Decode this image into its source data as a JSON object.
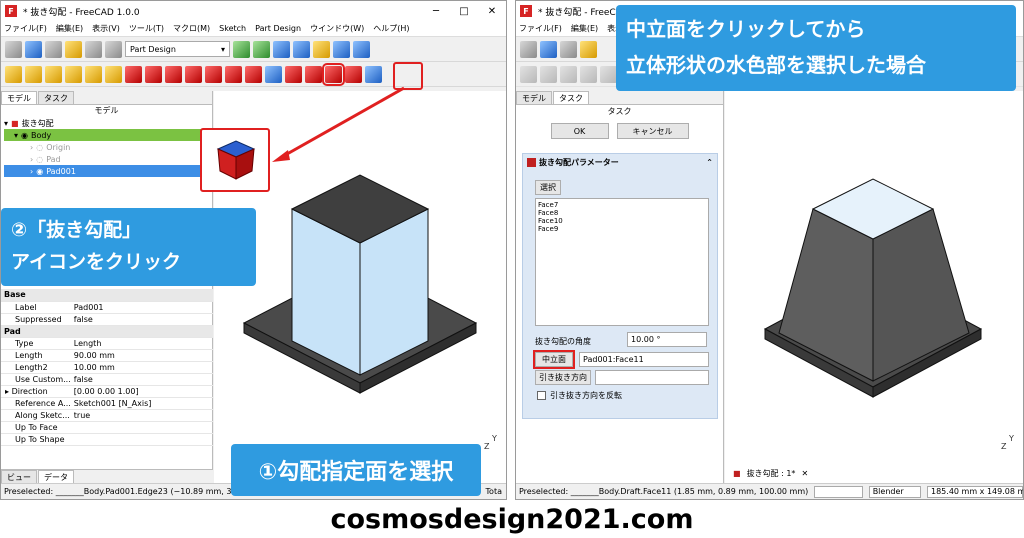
{
  "left": {
    "title": "* 抜き勾配 - FreeCAD 1.0.0",
    "menu": [
      "ファイル(F)",
      "編集(E)",
      "表示(V)",
      "ツール(T)",
      "マクロ(M)",
      "Sketch",
      "Part Design",
      "ウインドウ(W)",
      "ヘルプ(H)"
    ],
    "workbench": "Part Design",
    "tabs": [
      "モデル",
      "タスク"
    ],
    "panel_title": "モデル",
    "tree": {
      "doc": "抜き勾配",
      "body": "Body",
      "origin": "Origin",
      "pad": "Pad",
      "pad001": "Pad001"
    },
    "props": {
      "group_base": "Base",
      "label_k": "Label",
      "label_v": "Pad001",
      "suppressed_k": "Suppressed",
      "suppressed_v": "false",
      "group_pad": "Pad",
      "type_k": "Type",
      "type_v": "Length",
      "length_k": "Length",
      "length_v": "90.00 mm",
      "length2_k": "Length2",
      "length2_v": "10.00 mm",
      "usecustom_k": "Use Custom...",
      "usecustom_v": "false",
      "direction_k": "Direction",
      "direction_v": "[0.00 0.00 1.00]",
      "reference_k": "Reference A...",
      "reference_v": "Sketch001 [N_Axis]",
      "along_k": "Along Sketc...",
      "along_v": "true",
      "uptoface_k": "Up To Face",
      "uptoshape_k": "Up To Shape"
    },
    "bottom_tabs": [
      "ビュー",
      "データ"
    ],
    "status": "Preselected: _______Body.Pad001.Edge23 (−10.89 mm, 30",
    "status_right": "Tota",
    "callout_top": "②「抜き勾配」\nアイコンをクリック",
    "callout_bottom": "①勾配指定面を選択"
  },
  "right": {
    "title": "* 抜き勾配 - FreeCAD",
    "menu": [
      "ファイル(F)",
      "編集(E)",
      "表示("
    ],
    "tabs": [
      "モデル",
      "タスク"
    ],
    "panel_title": "タスク",
    "ok": "OK",
    "cancel": "キャンセル",
    "params_title": "抜き勾配パラメーター",
    "select_btn": "選択",
    "faces": [
      "Face7",
      "Face8",
      "Face10",
      "Face9"
    ],
    "angle_label": "抜き勾配の角度",
    "angle_value": "10.00 °",
    "neutral_btn": "中立面",
    "neutral_value": "Pad001:Face11",
    "pull_btn": "引き抜き方向",
    "reverse_label": "引き抜き方向を反転",
    "doc_tab": "抜き勾配 : 1*",
    "status": "Preselected: _______Body.Draft.Face11 (1.85 mm, 0.89 mm, 100.00 mm)",
    "nav_style": "Blender",
    "dims": "185.40 mm x 149.08 mm",
    "callout": "中立面をクリックしてから\n立体形状の水色部を選択した場合"
  },
  "footer": "cosmosdesign2021.com",
  "colors": {
    "callout": "#2f9be0",
    "highlight": "#e02020",
    "face_selected": "#c7e3f8"
  }
}
